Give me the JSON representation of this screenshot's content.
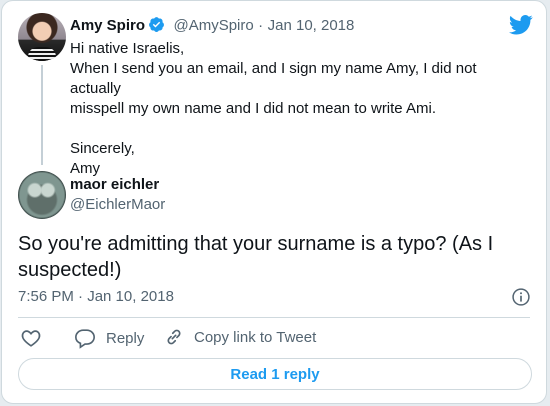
{
  "original_tweet": {
    "author_name": "Amy Spiro",
    "handle": "@AmySpiro",
    "separator": "·",
    "date": "Jan 10, 2018",
    "lines": [
      "Hi native Israelis,",
      "When I send you an email, and I sign my name Amy, I did not actually",
      "misspell my own name and I did not mean to write Ami.",
      "",
      "Sincerely,",
      "Amy"
    ]
  },
  "reply_tweet": {
    "author_name": "maor eichler",
    "handle": "@EichlerMaor",
    "text_line1": "So you're admitting that your surname is a typo? (As I",
    "text_line2": "suspected!)",
    "timestamp": "7:56 PM · Jan 10, 2018"
  },
  "actions": {
    "reply_label": "Reply",
    "copy_link_label": "Copy link to Tweet"
  },
  "read_replies_label": "Read 1 reply",
  "icons": {
    "brand": "twitter-bird-icon",
    "verified": "verified-badge-icon",
    "info": "info-icon",
    "like": "heart-icon",
    "reply": "comment-bubble-icon",
    "copy_link": "link-icon"
  },
  "colors": {
    "brand_blue": "#1d9bf0",
    "text": "#0f1419",
    "muted": "#536471",
    "border": "#cfd9de"
  }
}
